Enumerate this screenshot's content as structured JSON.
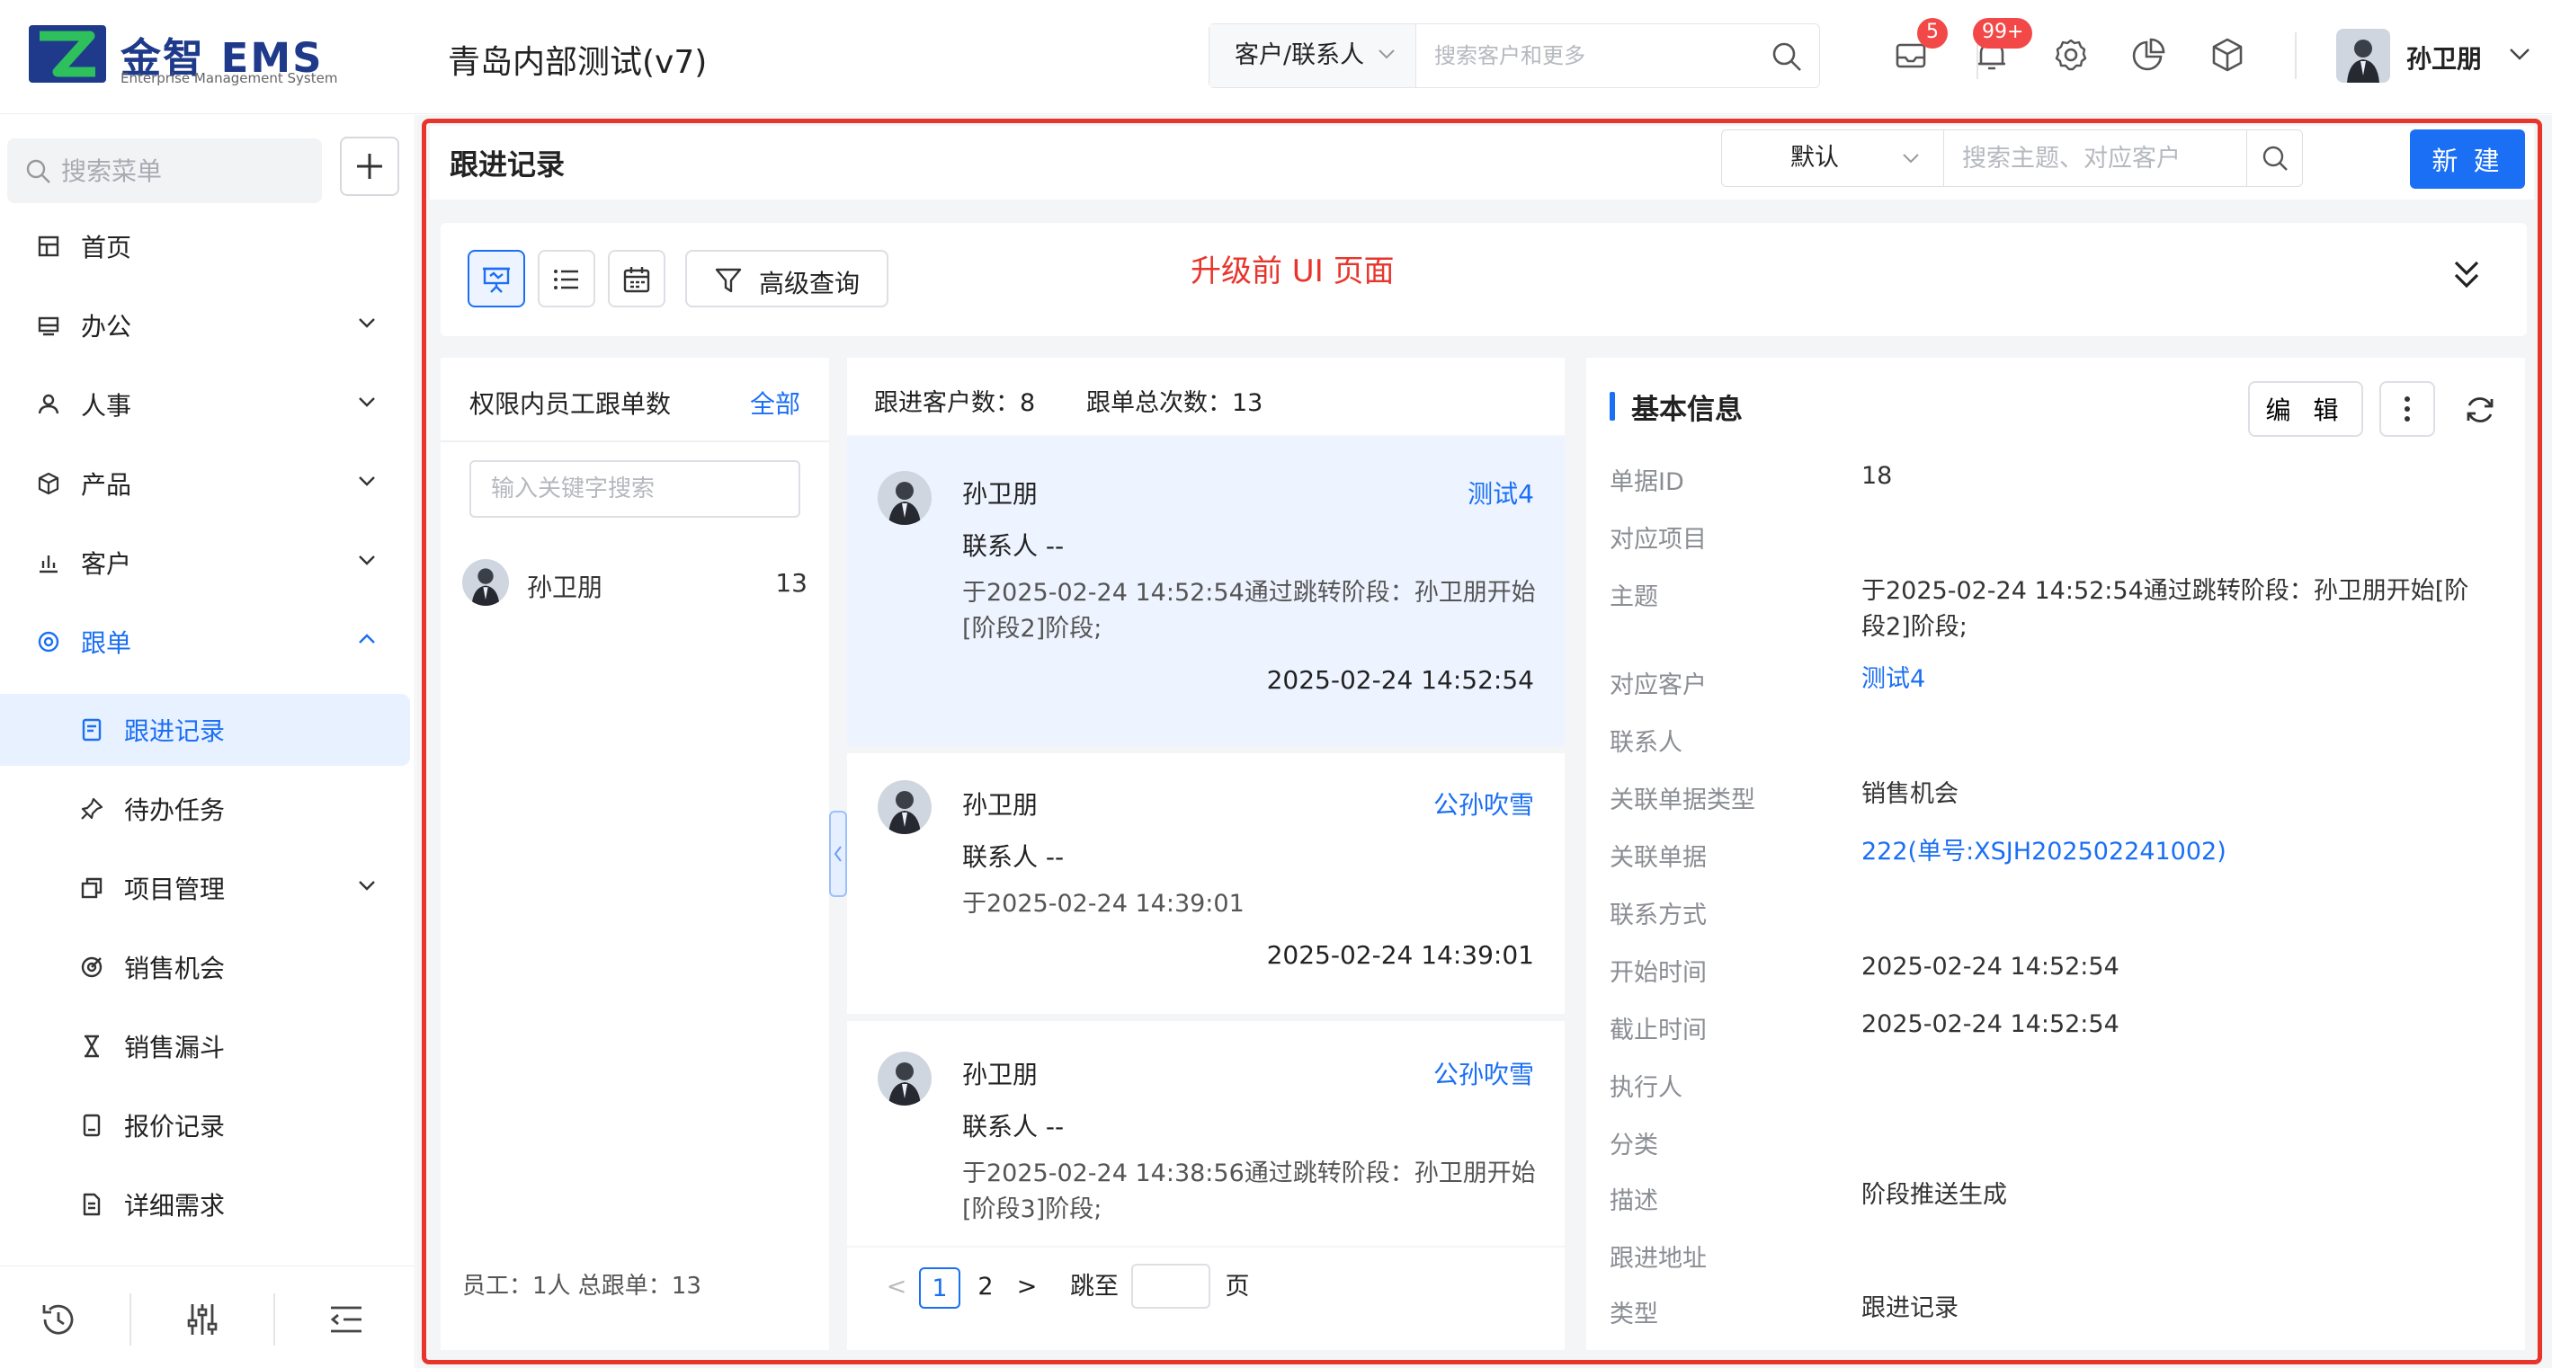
{
  "app": {
    "brand": "金智 EMS",
    "brand_sub": "Enterprise Management System",
    "company": "青岛内部测试(v7)"
  },
  "topbar": {
    "search_type": "客户/联系人",
    "search_placeholder": "搜索客户和更多",
    "mail_badge": "5",
    "notify_badge": "99+",
    "username": "孙卫朋"
  },
  "sidebar": {
    "search_placeholder": "搜索菜单",
    "items": [
      {
        "label": "首页",
        "icon": "home-grid-icon"
      },
      {
        "label": "办公",
        "icon": "office-icon"
      },
      {
        "label": "人事",
        "icon": "people-icon"
      },
      {
        "label": "产品",
        "icon": "cube-icon"
      },
      {
        "label": "客户",
        "icon": "chart-icon"
      },
      {
        "label": "跟单",
        "icon": "target-icon"
      }
    ],
    "subitems": [
      {
        "label": "跟进记录",
        "icon": "note-icon"
      },
      {
        "label": "待办任务",
        "icon": "pin-icon"
      },
      {
        "label": "项目管理",
        "icon": "copy-icon"
      },
      {
        "label": "销售机会",
        "icon": "target-icon"
      },
      {
        "label": "销售漏斗",
        "icon": "hourglass-icon"
      },
      {
        "label": "报价记录",
        "icon": "doc-icon"
      },
      {
        "label": "详细需求",
        "icon": "doc-lines-icon"
      }
    ]
  },
  "page": {
    "title": "跟进记录",
    "view_select": "默认",
    "search_placeholder": "搜索主题、对应客户",
    "new_label": "新 建",
    "advanced_query": "高级查询",
    "upgrade_note": "升级前 UI 页面"
  },
  "employee_panel": {
    "title": "权限内员工跟单数",
    "all_label": "全部",
    "search_placeholder": "输入关键字搜索",
    "employees": [
      {
        "name": "孙卫朋",
        "count": "13"
      }
    ],
    "footer": "员工：1人 总跟单：13"
  },
  "records": {
    "customer_count": "跟进客户数：8",
    "total_count": "跟单总次数：13",
    "contact_label": "联系人",
    "contact_value": "--",
    "items": [
      {
        "name": "孙卫朋",
        "customer": "测试4",
        "desc": "于2025-02-24 14:52:54通过跳转阶段：孙卫朋开始[阶段2]阶段;",
        "time": "2025-02-24 14:52:54"
      },
      {
        "name": "孙卫朋",
        "customer": "公孙吹雪",
        "desc": "于2025-02-24 14:39:01",
        "time": "2025-02-24 14:39:01"
      },
      {
        "name": "孙卫朋",
        "customer": "公孙吹雪",
        "desc": "于2025-02-24 14:38:56通过跳转阶段：孙卫朋开始[阶段3]阶段;",
        "time": ""
      }
    ],
    "pager": {
      "prev": "<",
      "page1": "1",
      "page2": "2",
      "next": ">",
      "jump_label": "跳至",
      "page_unit": "页"
    }
  },
  "detail": {
    "title": "基本信息",
    "edit_label": "编 辑",
    "fields": [
      {
        "label": "单据ID",
        "value": "18"
      },
      {
        "label": "对应项目",
        "value": ""
      },
      {
        "label": "主题",
        "value": "于2025-02-24 14:52:54通过跳转阶段：孙卫朋开始[阶段2]阶段;"
      },
      {
        "label": "对应客户",
        "value": "测试4"
      },
      {
        "label": "联系人",
        "value": ""
      },
      {
        "label": "关联单据类型",
        "value": "销售机会"
      },
      {
        "label": "关联单据",
        "value": "222(单号:XSJH202502241002)"
      },
      {
        "label": "联系方式",
        "value": ""
      },
      {
        "label": "开始时间",
        "value": "2025-02-24 14:52:54"
      },
      {
        "label": "截止时间",
        "value": "2025-02-24 14:52:54"
      },
      {
        "label": "执行人",
        "value": ""
      },
      {
        "label": "分类",
        "value": ""
      },
      {
        "label": "描述",
        "value": "阶段推送生成"
      },
      {
        "label": "跟进地址",
        "value": ""
      },
      {
        "label": "类型",
        "value": "跟进记录"
      }
    ]
  },
  "colors": {
    "accent": "#1a6ff5",
    "danger": "#e8352c",
    "selected_bg": "#eef4ff"
  }
}
